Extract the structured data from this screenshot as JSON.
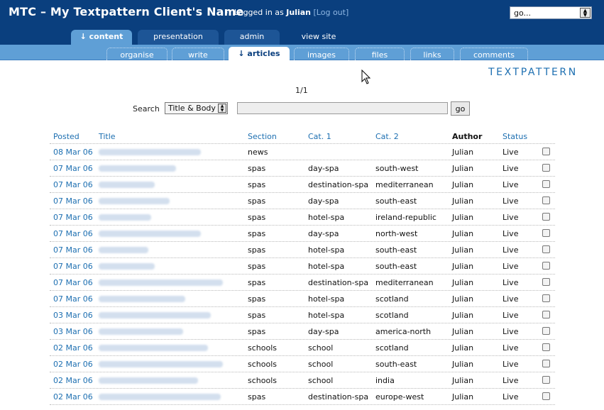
{
  "header": {
    "site_title": "MTC – My Textpattern Client's Name",
    "login_arrow": "›",
    "login_prefix": "Logged in as",
    "user": "Julian",
    "bracket_open": "[",
    "logout": "Log out",
    "bracket_close": "]",
    "jump_value": "go..."
  },
  "tabs": {
    "content": "content",
    "presentation": "presentation",
    "admin": "admin",
    "view_site": "view site"
  },
  "subtabs": [
    "organise",
    "write",
    "articles",
    "images",
    "files",
    "links",
    "comments"
  ],
  "logo": "TEXTPATTERN",
  "paging": "1/1",
  "search": {
    "label": "Search",
    "method": "Title & Body",
    "value": "",
    "go": "go"
  },
  "columns": {
    "posted": "Posted",
    "title": "Title",
    "section": "Section",
    "cat1": "Cat. 1",
    "cat2": "Cat. 2",
    "author": "Author",
    "status": "Status"
  },
  "articles": [
    {
      "posted": "08 Mar 06",
      "section": "news",
      "cat1": "",
      "cat2": "",
      "author": "Julian",
      "status": "Live",
      "title_len": 0.82
    },
    {
      "posted": "07 Mar 06",
      "section": "spas",
      "cat1": "day-spa",
      "cat2": "south-west",
      "author": "Julian",
      "status": "Live",
      "title_len": 0.62
    },
    {
      "posted": "07 Mar 06",
      "section": "spas",
      "cat1": "destination-spa",
      "cat2": "mediterranean",
      "author": "Julian",
      "status": "Live",
      "title_len": 0.45
    },
    {
      "posted": "07 Mar 06",
      "section": "spas",
      "cat1": "day-spa",
      "cat2": "south-east",
      "author": "Julian",
      "status": "Live",
      "title_len": 0.57
    },
    {
      "posted": "07 Mar 06",
      "section": "spas",
      "cat1": "hotel-spa",
      "cat2": "ireland-republic",
      "author": "Julian",
      "status": "Live",
      "title_len": 0.42
    },
    {
      "posted": "07 Mar 06",
      "section": "spas",
      "cat1": "day-spa",
      "cat2": "north-west",
      "author": "Julian",
      "status": "Live",
      "title_len": 0.82
    },
    {
      "posted": "07 Mar 06",
      "section": "spas",
      "cat1": "hotel-spa",
      "cat2": "south-east",
      "author": "Julian",
      "status": "Live",
      "title_len": 0.4
    },
    {
      "posted": "07 Mar 06",
      "section": "spas",
      "cat1": "hotel-spa",
      "cat2": "south-east",
      "author": "Julian",
      "status": "Live",
      "title_len": 0.45
    },
    {
      "posted": "07 Mar 06",
      "section": "spas",
      "cat1": "destination-spa",
      "cat2": "mediterranean",
      "author": "Julian",
      "status": "Live",
      "title_len": 1.0
    },
    {
      "posted": "07 Mar 06",
      "section": "spas",
      "cat1": "hotel-spa",
      "cat2": "scotland",
      "author": "Julian",
      "status": "Live",
      "title_len": 0.7
    },
    {
      "posted": "03 Mar 06",
      "section": "spas",
      "cat1": "hotel-spa",
      "cat2": "scotland",
      "author": "Julian",
      "status": "Live",
      "title_len": 0.9
    },
    {
      "posted": "03 Mar 06",
      "section": "spas",
      "cat1": "day-spa",
      "cat2": "america-north",
      "author": "Julian",
      "status": "Live",
      "title_len": 0.68
    },
    {
      "posted": "02 Mar 06",
      "section": "schools",
      "cat1": "school",
      "cat2": "scotland",
      "author": "Julian",
      "status": "Live",
      "title_len": 0.88
    },
    {
      "posted": "02 Mar 06",
      "section": "schools",
      "cat1": "school",
      "cat2": "south-east",
      "author": "Julian",
      "status": "Live",
      "title_len": 1.0
    },
    {
      "posted": "02 Mar 06",
      "section": "schools",
      "cat1": "school",
      "cat2": "india",
      "author": "Julian",
      "status": "Live",
      "title_len": 0.8
    },
    {
      "posted": "02 Mar 06",
      "section": "spas",
      "cat1": "destination-spa",
      "cat2": "europe-west",
      "author": "Julian",
      "status": "Live",
      "title_len": 0.98
    }
  ]
}
